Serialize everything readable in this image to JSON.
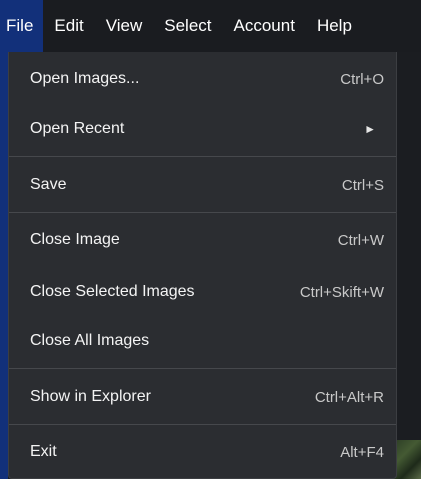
{
  "menubar": {
    "items": [
      {
        "label": "File"
      },
      {
        "label": "Edit"
      },
      {
        "label": "View"
      },
      {
        "label": "Select"
      },
      {
        "label": "Account"
      },
      {
        "label": "Help"
      }
    ]
  },
  "file_menu": {
    "open_images": {
      "label": "Open Images...",
      "shortcut": "Ctrl+O"
    },
    "open_recent": {
      "label": "Open Recent",
      "submenu_icon": "►"
    },
    "save": {
      "label": "Save",
      "shortcut": "Ctrl+S"
    },
    "close_image": {
      "label": "Close Image",
      "shortcut": "Ctrl+W"
    },
    "close_selected": {
      "label": "Close Selected Images",
      "shortcut": "Ctrl+Skift+W"
    },
    "close_all": {
      "label": "Close All Images"
    },
    "show_in_explorer": {
      "label": "Show in Explorer",
      "shortcut": "Ctrl+Alt+R"
    },
    "exit": {
      "label": "Exit",
      "shortcut": "Alt+F4"
    }
  },
  "colors": {
    "accent": "#12307a",
    "menu_bg": "#2b2d31",
    "menubar_bg": "#1a1c20"
  }
}
